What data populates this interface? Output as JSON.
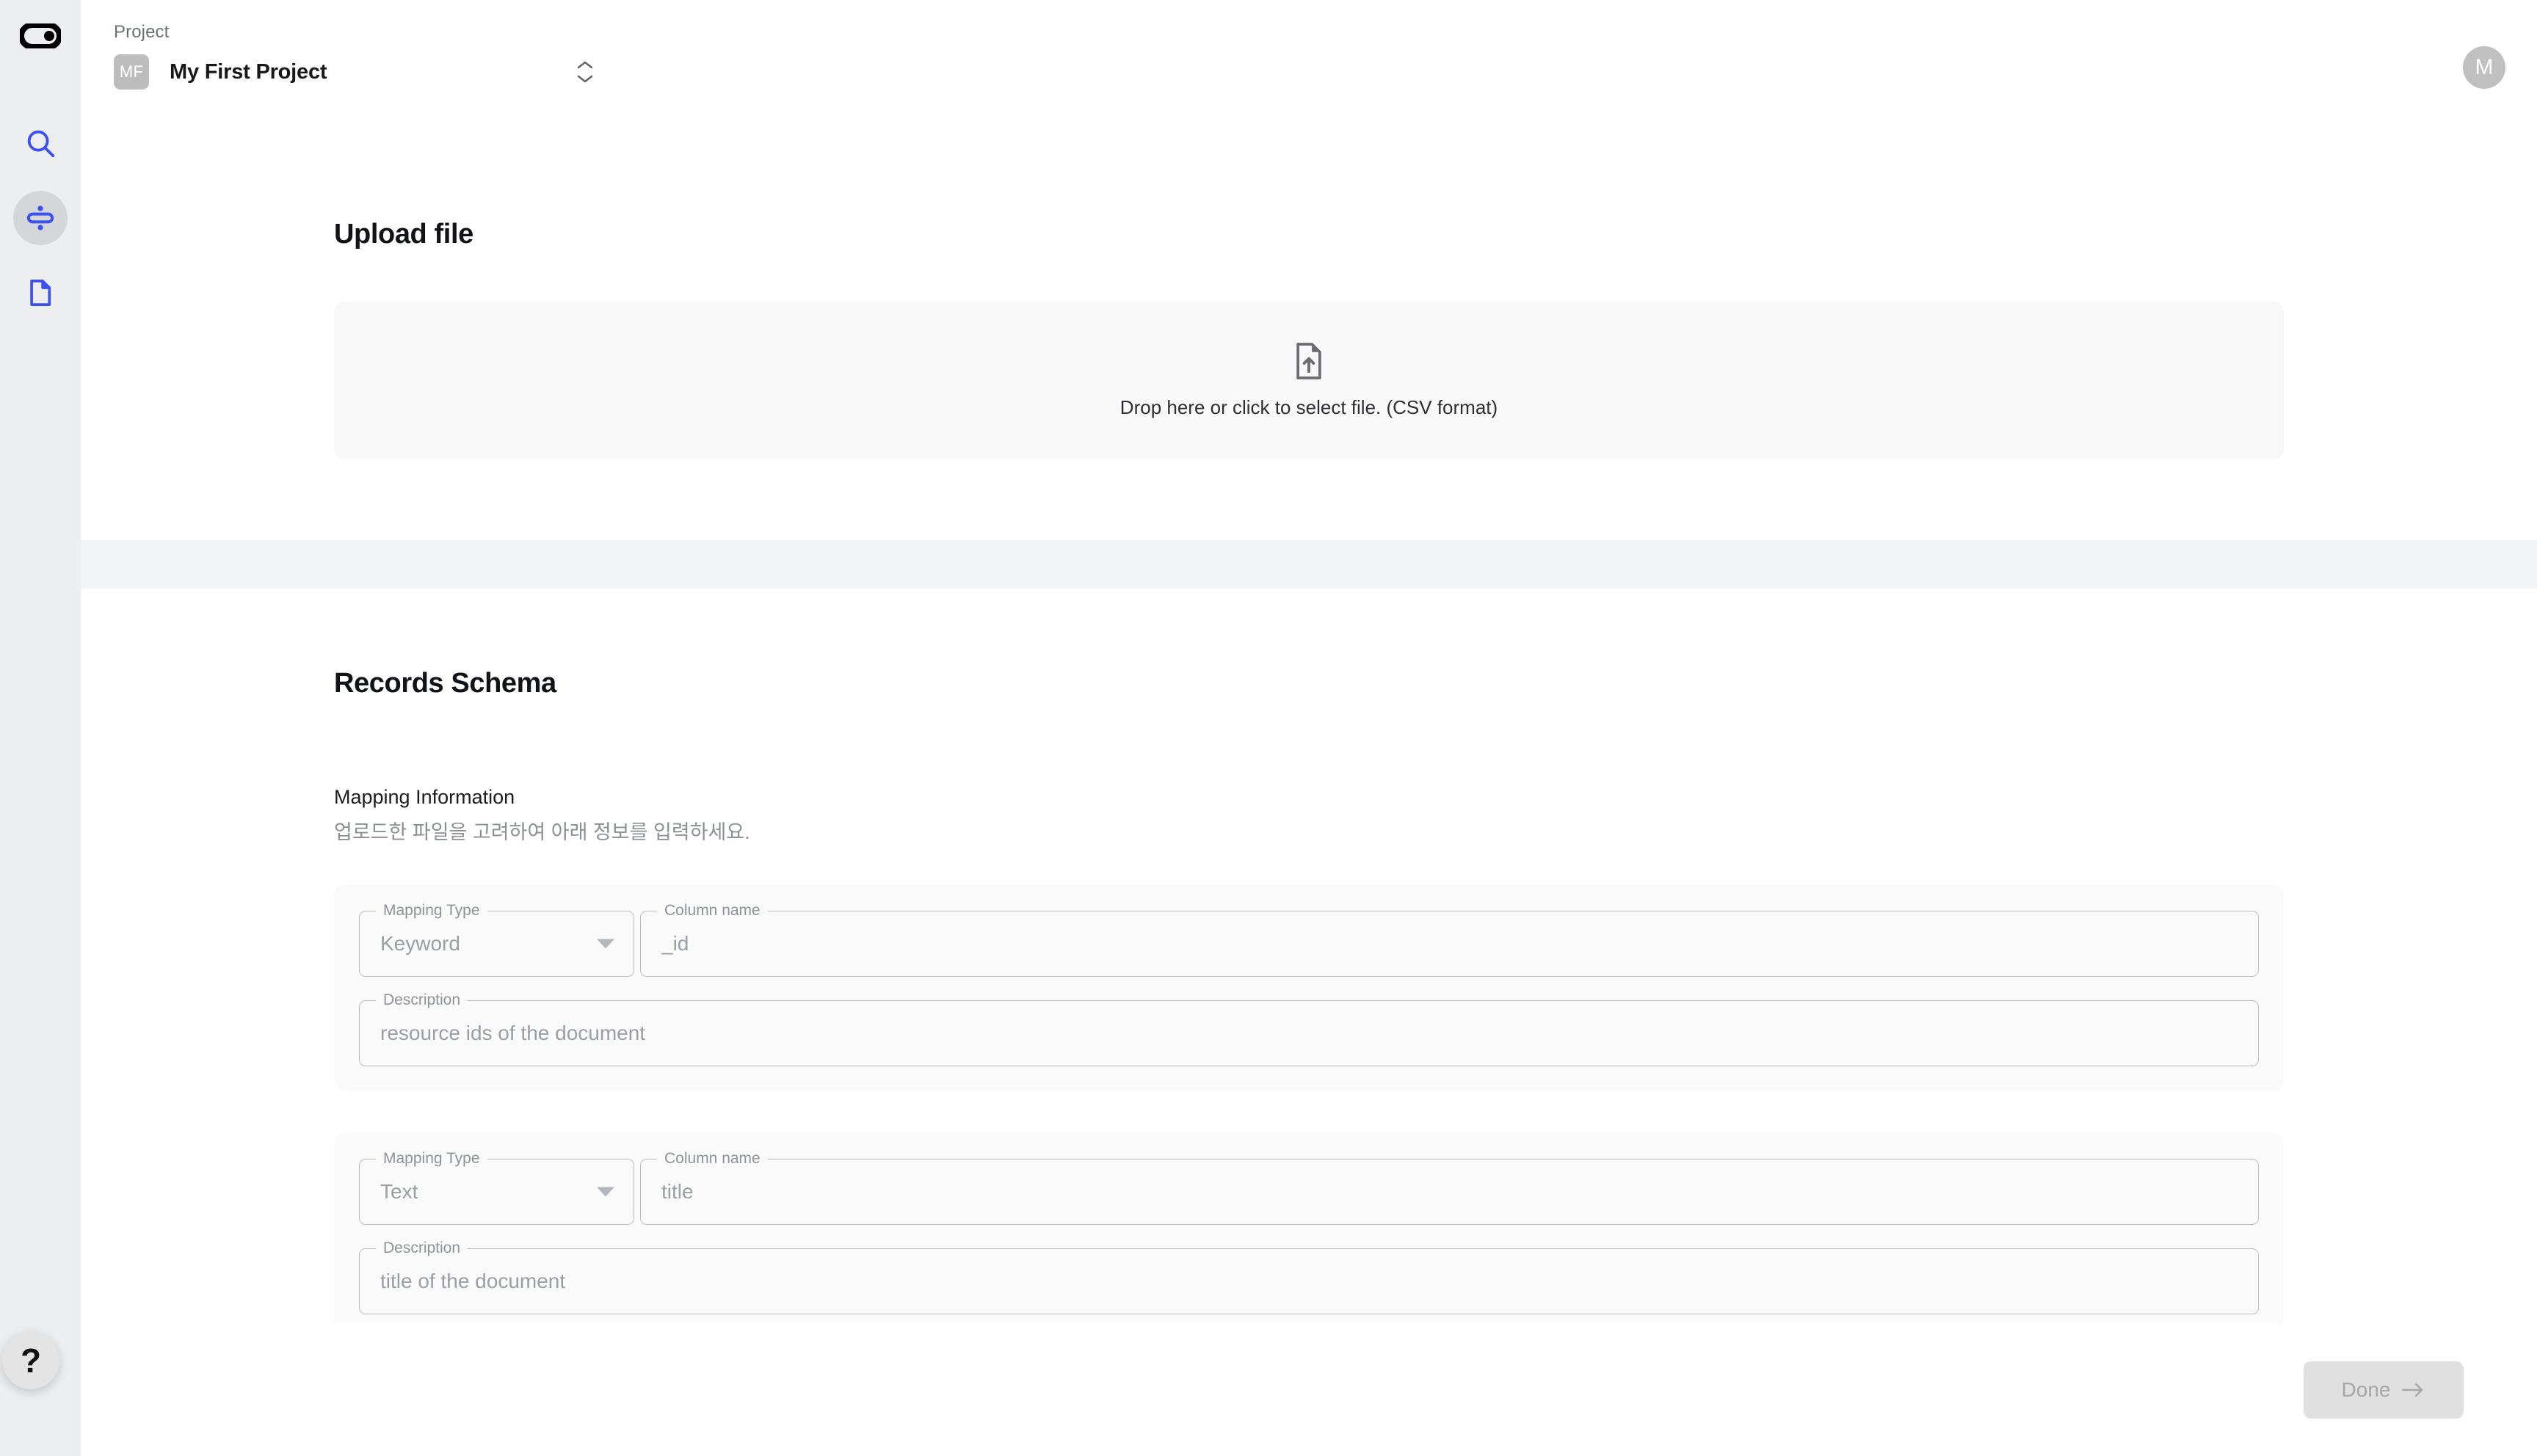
{
  "sidebar": {
    "logo_icon": "toggle-pill-logo",
    "items": [
      {
        "icon": "search-icon",
        "name": "search",
        "active": false
      },
      {
        "icon": "divide-icon",
        "name": "records",
        "active": true
      },
      {
        "icon": "document-icon",
        "name": "documents",
        "active": false
      }
    ],
    "help_label": "?"
  },
  "topbar": {
    "project_label": "Project",
    "project_initials": "MF",
    "project_name": "My First Project",
    "selector_icon": "chevron-up-down-icon",
    "user_initial": "M"
  },
  "upload": {
    "title": "Upload file",
    "icon": "file-upload-icon",
    "dropzone_text": "Drop here or click to select file. (CSV format)"
  },
  "schema": {
    "title": "Records Schema",
    "mapping_title": "Mapping Information",
    "mapping_subtitle": "업로드한 파일을 고려하여 아래 정보를 입력하세요.",
    "labels": {
      "mapping_type": "Mapping Type",
      "column_name": "Column name",
      "description": "Description"
    },
    "rows": [
      {
        "mapping_type": "Keyword",
        "column_name": "_id",
        "description": "resource ids of the document"
      },
      {
        "mapping_type": "Text",
        "column_name": "title",
        "description": "title of the document"
      }
    ]
  },
  "footer": {
    "done_label": "Done",
    "done_icon": "arrow-right-icon",
    "done_disabled": true
  },
  "colors": {
    "accent": "#3b50f0",
    "sidebar_bg": "#eceef0",
    "band_bg": "#f3f4f5",
    "card_bg": "#fafafa",
    "dropzone_bg": "#f8f8f9",
    "disabled_btn_bg": "#e0e0e0"
  }
}
